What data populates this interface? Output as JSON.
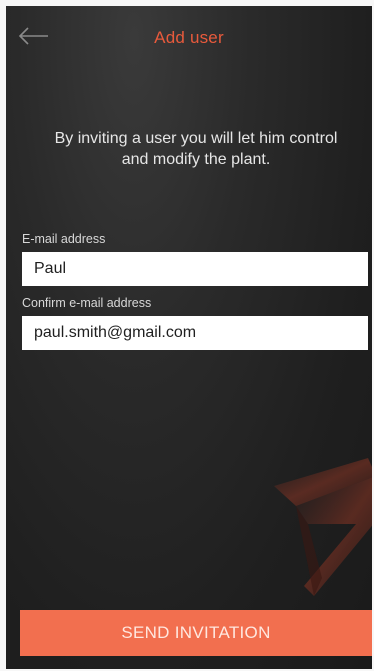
{
  "header": {
    "title": "Add user",
    "back_icon": "arrow-left-icon"
  },
  "intro_text": "By inviting a user you will let him control and modify the plant.",
  "form": {
    "email": {
      "label": "E-mail address",
      "value": "Paul"
    },
    "confirm_email": {
      "label": "Confirm e-mail address",
      "value": "paul.smith@gmail.com"
    }
  },
  "send_button": {
    "label": "SEND INVITATION"
  },
  "colors": {
    "accent": "#e85a3c",
    "button": "#f26f4f",
    "background": "#222222"
  }
}
